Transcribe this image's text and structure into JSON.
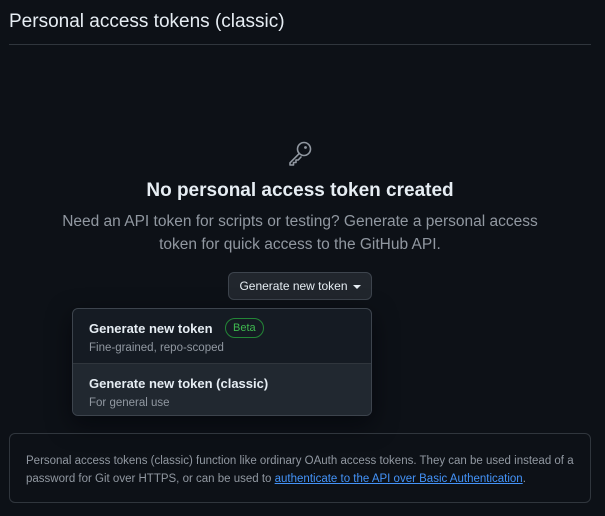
{
  "header": {
    "title": "Personal access tokens (classic)"
  },
  "blankslate": {
    "icon": "key-icon",
    "title": "No personal access token created",
    "description": "Need an API token for scripts or testing? Generate a personal access token for quick access to the GitHub API."
  },
  "generate_button": {
    "label": "Generate new token"
  },
  "menu": {
    "items": [
      {
        "title": "Generate new token",
        "badge": "Beta",
        "subtitle": "Fine-grained, repo-scoped"
      },
      {
        "title": "Generate new token (classic)",
        "subtitle": "For general use"
      }
    ]
  },
  "note": {
    "text": "Personal access tokens (classic) function like ordinary OAuth access tokens. They can be used instead of a password for Git over HTTPS, or can be used to ",
    "link": "authenticate to the API over Basic Authentication",
    "suffix": "."
  },
  "colors": {
    "background": "#0d1117",
    "border": "#30363d",
    "text_primary": "#e6edf3",
    "text_muted": "#9198a1",
    "link": "#4493f8",
    "badge_green": "#3fb950"
  }
}
